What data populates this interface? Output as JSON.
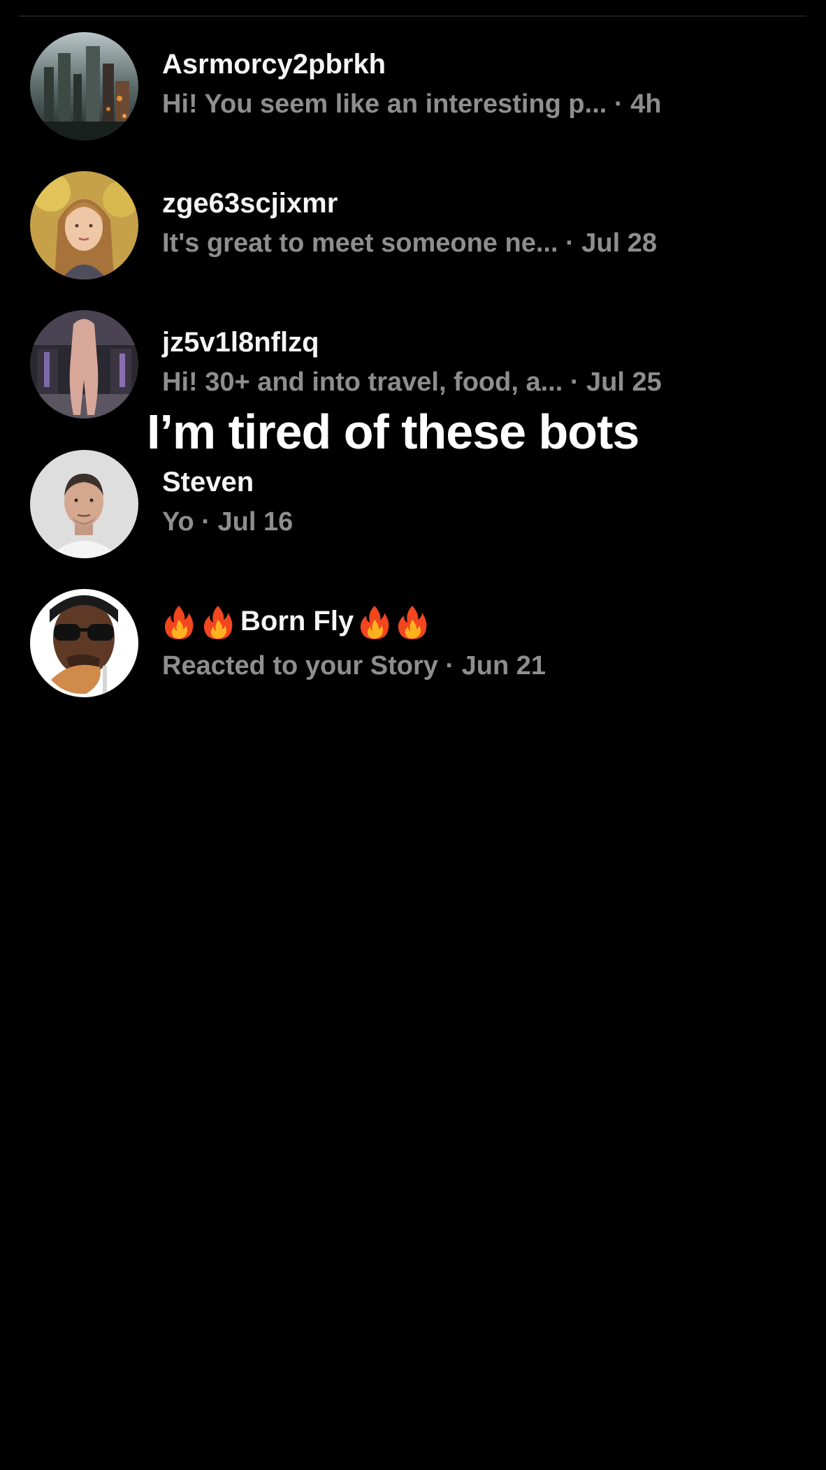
{
  "overlay_caption": "I’m tired of these bots",
  "threads": [
    {
      "username": "Asrmorcy2pbrkh",
      "snippet": "Hi! You seem like an interesting p...",
      "separator": " · ",
      "time": "4h",
      "avatar": "city-skyline-avatar"
    },
    {
      "username": "zge63scjixmr",
      "snippet": "It's great to meet someone ne...",
      "separator": " · ",
      "time": "Jul 28",
      "avatar": "woman-portrait-avatar"
    },
    {
      "username": "jz5v1l8nflzq",
      "snippet": "Hi! 30+ and into travel, food, a...",
      "separator": " · ",
      "time": "Jul 25",
      "avatar": "fitness-photo-avatar"
    },
    {
      "username": "Steven",
      "snippet": "Yo",
      "separator": " · ",
      "time": "Jul 16",
      "avatar": "man-portrait-avatar"
    },
    {
      "username_emoji_left": "fire-icon fire-icon",
      "username": "Born Fly",
      "username_emoji_right": "fire-icon fire-icon",
      "snippet": "Reacted to your Story",
      "separator": " · ",
      "time": "Jun 21",
      "avatar": "sunglasses-man-avatar"
    }
  ],
  "colors": {
    "background": "#000000",
    "username": "#f5f5f5",
    "preview": "#8e8e8e"
  }
}
